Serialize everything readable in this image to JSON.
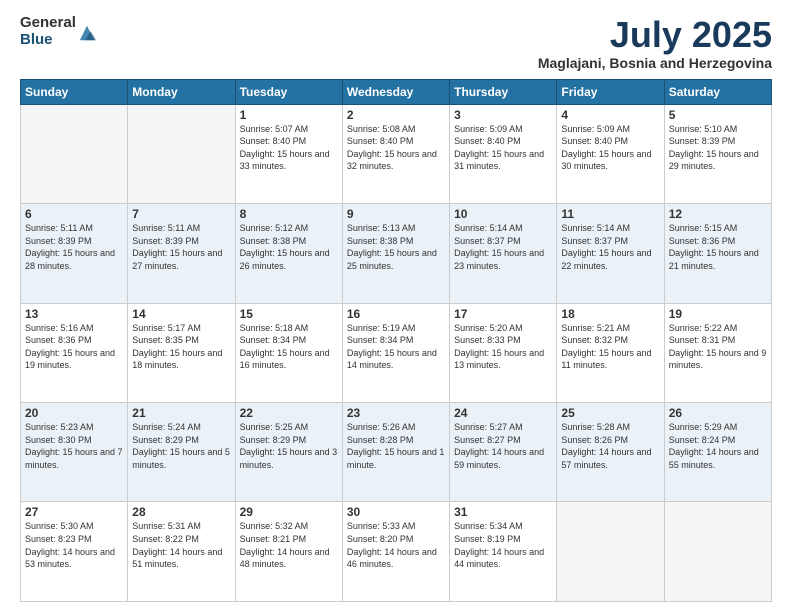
{
  "logo": {
    "general": "General",
    "blue": "Blue"
  },
  "title": "July 2025",
  "location": "Maglajani, Bosnia and Herzegovina",
  "days_of_week": [
    "Sunday",
    "Monday",
    "Tuesday",
    "Wednesday",
    "Thursday",
    "Friday",
    "Saturday"
  ],
  "weeks": [
    [
      {
        "day": "",
        "info": ""
      },
      {
        "day": "",
        "info": ""
      },
      {
        "day": "1",
        "info": "Sunrise: 5:07 AM\nSunset: 8:40 PM\nDaylight: 15 hours and 33 minutes."
      },
      {
        "day": "2",
        "info": "Sunrise: 5:08 AM\nSunset: 8:40 PM\nDaylight: 15 hours and 32 minutes."
      },
      {
        "day": "3",
        "info": "Sunrise: 5:09 AM\nSunset: 8:40 PM\nDaylight: 15 hours and 31 minutes."
      },
      {
        "day": "4",
        "info": "Sunrise: 5:09 AM\nSunset: 8:40 PM\nDaylight: 15 hours and 30 minutes."
      },
      {
        "day": "5",
        "info": "Sunrise: 5:10 AM\nSunset: 8:39 PM\nDaylight: 15 hours and 29 minutes."
      }
    ],
    [
      {
        "day": "6",
        "info": "Sunrise: 5:11 AM\nSunset: 8:39 PM\nDaylight: 15 hours and 28 minutes."
      },
      {
        "day": "7",
        "info": "Sunrise: 5:11 AM\nSunset: 8:39 PM\nDaylight: 15 hours and 27 minutes."
      },
      {
        "day": "8",
        "info": "Sunrise: 5:12 AM\nSunset: 8:38 PM\nDaylight: 15 hours and 26 minutes."
      },
      {
        "day": "9",
        "info": "Sunrise: 5:13 AM\nSunset: 8:38 PM\nDaylight: 15 hours and 25 minutes."
      },
      {
        "day": "10",
        "info": "Sunrise: 5:14 AM\nSunset: 8:37 PM\nDaylight: 15 hours and 23 minutes."
      },
      {
        "day": "11",
        "info": "Sunrise: 5:14 AM\nSunset: 8:37 PM\nDaylight: 15 hours and 22 minutes."
      },
      {
        "day": "12",
        "info": "Sunrise: 5:15 AM\nSunset: 8:36 PM\nDaylight: 15 hours and 21 minutes."
      }
    ],
    [
      {
        "day": "13",
        "info": "Sunrise: 5:16 AM\nSunset: 8:36 PM\nDaylight: 15 hours and 19 minutes."
      },
      {
        "day": "14",
        "info": "Sunrise: 5:17 AM\nSunset: 8:35 PM\nDaylight: 15 hours and 18 minutes."
      },
      {
        "day": "15",
        "info": "Sunrise: 5:18 AM\nSunset: 8:34 PM\nDaylight: 15 hours and 16 minutes."
      },
      {
        "day": "16",
        "info": "Sunrise: 5:19 AM\nSunset: 8:34 PM\nDaylight: 15 hours and 14 minutes."
      },
      {
        "day": "17",
        "info": "Sunrise: 5:20 AM\nSunset: 8:33 PM\nDaylight: 15 hours and 13 minutes."
      },
      {
        "day": "18",
        "info": "Sunrise: 5:21 AM\nSunset: 8:32 PM\nDaylight: 15 hours and 11 minutes."
      },
      {
        "day": "19",
        "info": "Sunrise: 5:22 AM\nSunset: 8:31 PM\nDaylight: 15 hours and 9 minutes."
      }
    ],
    [
      {
        "day": "20",
        "info": "Sunrise: 5:23 AM\nSunset: 8:30 PM\nDaylight: 15 hours and 7 minutes."
      },
      {
        "day": "21",
        "info": "Sunrise: 5:24 AM\nSunset: 8:29 PM\nDaylight: 15 hours and 5 minutes."
      },
      {
        "day": "22",
        "info": "Sunrise: 5:25 AM\nSunset: 8:29 PM\nDaylight: 15 hours and 3 minutes."
      },
      {
        "day": "23",
        "info": "Sunrise: 5:26 AM\nSunset: 8:28 PM\nDaylight: 15 hours and 1 minute."
      },
      {
        "day": "24",
        "info": "Sunrise: 5:27 AM\nSunset: 8:27 PM\nDaylight: 14 hours and 59 minutes."
      },
      {
        "day": "25",
        "info": "Sunrise: 5:28 AM\nSunset: 8:26 PM\nDaylight: 14 hours and 57 minutes."
      },
      {
        "day": "26",
        "info": "Sunrise: 5:29 AM\nSunset: 8:24 PM\nDaylight: 14 hours and 55 minutes."
      }
    ],
    [
      {
        "day": "27",
        "info": "Sunrise: 5:30 AM\nSunset: 8:23 PM\nDaylight: 14 hours and 53 minutes."
      },
      {
        "day": "28",
        "info": "Sunrise: 5:31 AM\nSunset: 8:22 PM\nDaylight: 14 hours and 51 minutes."
      },
      {
        "day": "29",
        "info": "Sunrise: 5:32 AM\nSunset: 8:21 PM\nDaylight: 14 hours and 48 minutes."
      },
      {
        "day": "30",
        "info": "Sunrise: 5:33 AM\nSunset: 8:20 PM\nDaylight: 14 hours and 46 minutes."
      },
      {
        "day": "31",
        "info": "Sunrise: 5:34 AM\nSunset: 8:19 PM\nDaylight: 14 hours and 44 minutes."
      },
      {
        "day": "",
        "info": ""
      },
      {
        "day": "",
        "info": ""
      }
    ]
  ]
}
